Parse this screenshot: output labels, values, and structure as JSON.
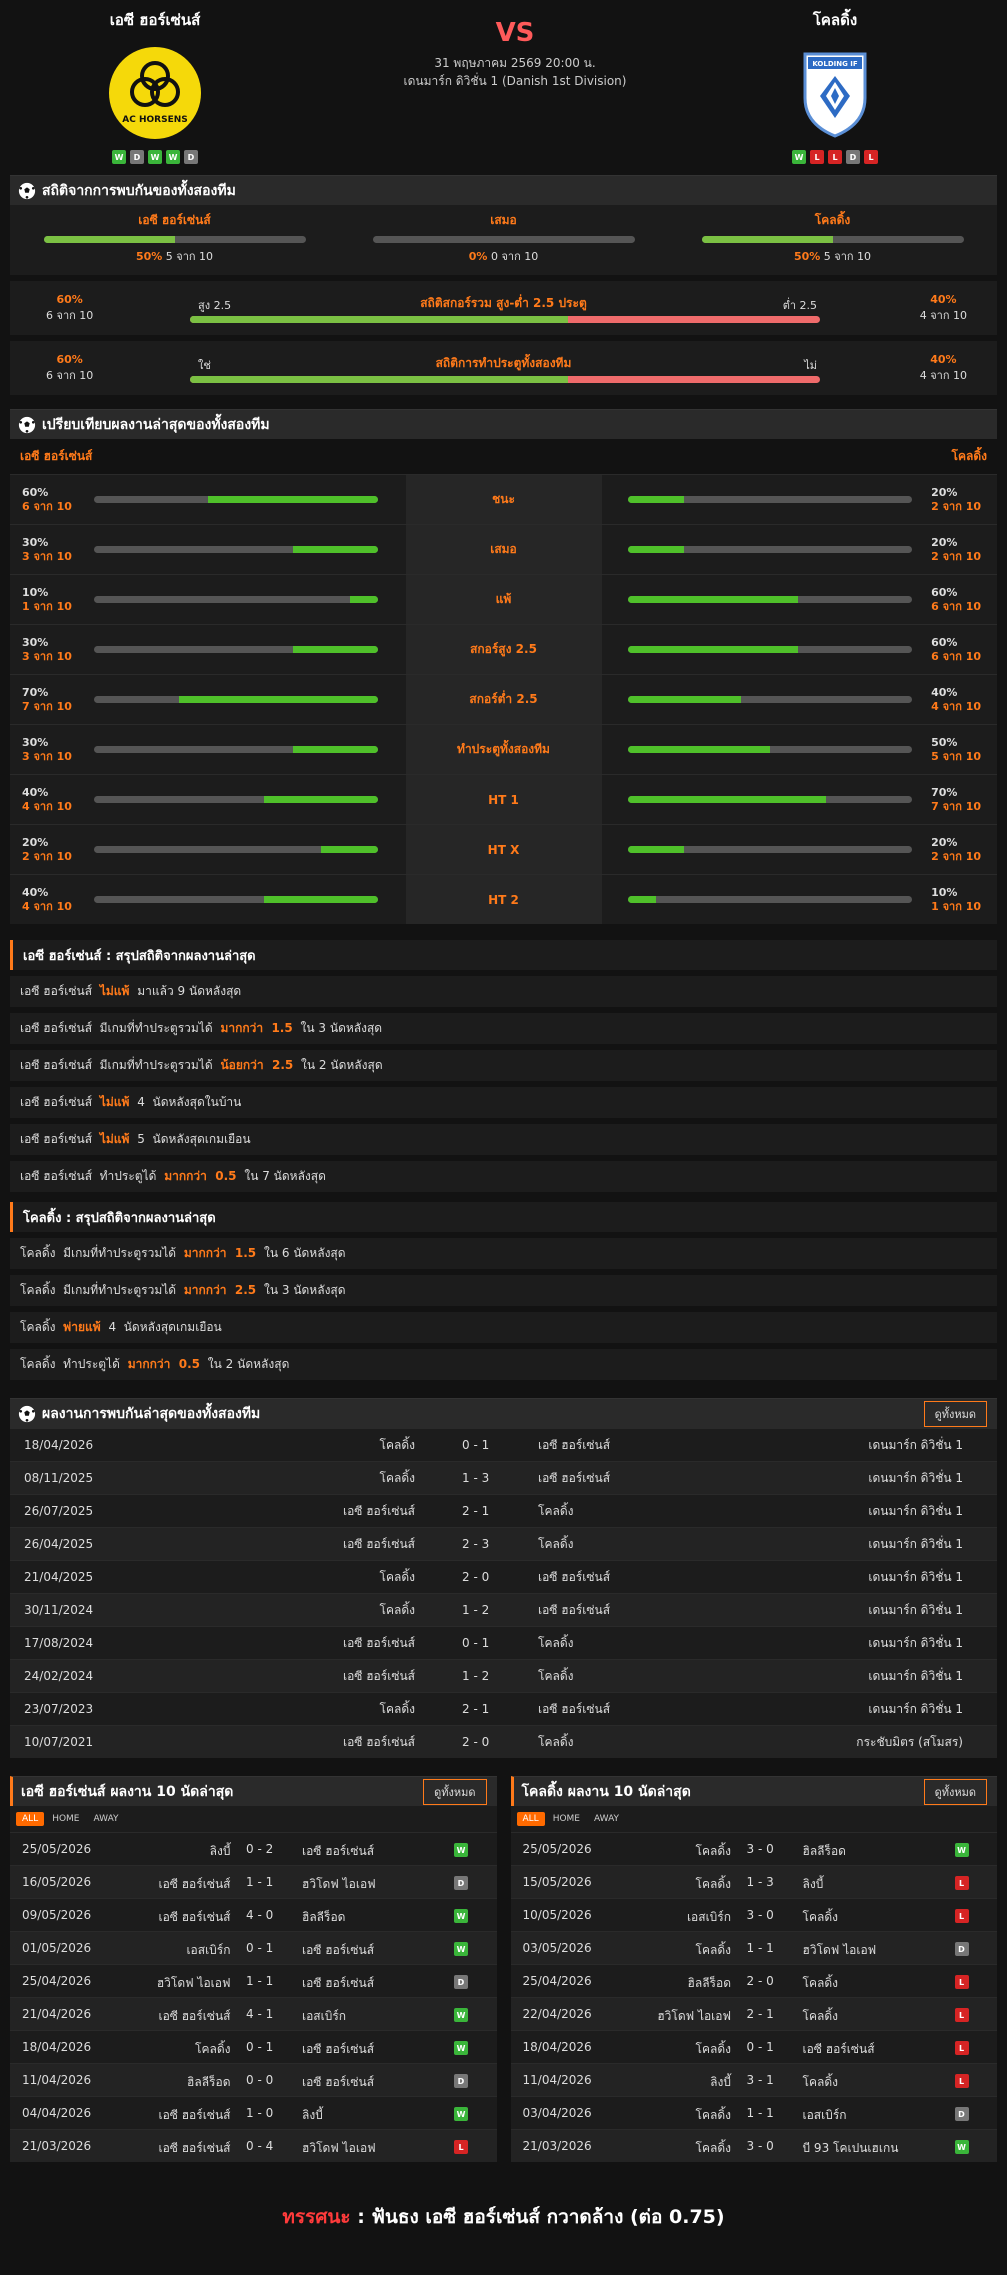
{
  "match": {
    "home": "เอซี ฮอร์เซ่นส์",
    "away": "โคลดิ้ง",
    "vs": "VS",
    "datetime": "31 พฤษภาคม 2569 20:00 น.",
    "league": "เดนมาร์ก ดิวิชั่น 1 (Danish 1st Division)",
    "home_logo_text": "AC HORSENS",
    "away_logo_text": "KOLDING IF",
    "home_form": [
      "W",
      "D",
      "W",
      "W",
      "D"
    ],
    "away_form": [
      "W",
      "L",
      "L",
      "D",
      "L"
    ]
  },
  "h2h_stats": {
    "title": "สถิติจากการพบกันของทั้งสองทีม",
    "cols": [
      {
        "label": "เอซี ฮอร์เซ่นส์",
        "pct": "50%",
        "count": "5 จาก 10",
        "value": 0.5
      },
      {
        "label": "เสมอ",
        "pct": "0%",
        "count": "0 จาก 10",
        "value": 0
      },
      {
        "label": "โคลดิ้ง",
        "pct": "50%",
        "count": "5 จาก 10",
        "value": 0.5
      }
    ],
    "ou": {
      "lp": "60%",
      "lc": "6 จาก 10",
      "lt": "สูง 2.5",
      "title": "สถิติสกอร์รวม สูง-ต่ำ 2.5 ประตู",
      "rt": "ต่ำ 2.5",
      "rp": "40%",
      "rc": "4 จาก 10",
      "value": 0.6
    },
    "btts": {
      "lp": "60%",
      "lc": "6 จาก 10",
      "lt": "ใช่",
      "title": "สถิติการทำประตูทั้งสองทีม",
      "rt": "ไม่",
      "rp": "40%",
      "rc": "4 จาก 10",
      "value": 0.6
    }
  },
  "compare": {
    "title": "เปรียบเทียบผลงานล่าสุดของทั้งสองทีม",
    "home": "เอซี ฮอร์เซ่นส์",
    "away": "โคลดิ้ง",
    "rows": [
      {
        "label": "ชนะ",
        "hp": "60%",
        "hc": "6 จาก 10",
        "hv": 0.6,
        "ap": "20%",
        "ac": "2 จาก 10",
        "av": 0.2
      },
      {
        "label": "เสมอ",
        "hp": "30%",
        "hc": "3 จาก 10",
        "hv": 0.3,
        "ap": "20%",
        "ac": "2 จาก 10",
        "av": 0.2
      },
      {
        "label": "แพ้",
        "hp": "10%",
        "hc": "1 จาก 10",
        "hv": 0.1,
        "ap": "60%",
        "ac": "6 จาก 10",
        "av": 0.6
      },
      {
        "label": "สกอร์สูง 2.5",
        "hp": "30%",
        "hc": "3 จาก 10",
        "hv": 0.3,
        "ap": "60%",
        "ac": "6 จาก 10",
        "av": 0.6
      },
      {
        "label": "สกอร์ต่ำ 2.5",
        "hp": "70%",
        "hc": "7 จาก 10",
        "hv": 0.7,
        "ap": "40%",
        "ac": "4 จาก 10",
        "av": 0.4
      },
      {
        "label": "ทำประตูทั้งสองทีม",
        "hp": "30%",
        "hc": "3 จาก 10",
        "hv": 0.3,
        "ap": "50%",
        "ac": "5 จาก 10",
        "av": 0.5
      },
      {
        "label": "HT 1",
        "hp": "40%",
        "hc": "4 จาก 10",
        "hv": 0.4,
        "ap": "70%",
        "ac": "7 จาก 10",
        "av": 0.7
      },
      {
        "label": "HT X",
        "hp": "20%",
        "hc": "2 จาก 10",
        "hv": 0.2,
        "ap": "20%",
        "ac": "2 จาก 10",
        "av": 0.2
      },
      {
        "label": "HT 2",
        "hp": "40%",
        "hc": "4 จาก 10",
        "hv": 0.4,
        "ap": "10%",
        "ac": "1 จาก 10",
        "av": 0.1
      }
    ]
  },
  "home_summary": {
    "title": "เอซี ฮอร์เซ่นส์ : สรุปสถิติจากผลงานล่าสุด",
    "rows": [
      [
        "เอซี ฮอร์เซ่นส์ ",
        "ไม่แพ้",
        " มาแล้ว 9 นัดหลังสุด"
      ],
      [
        "เอซี ฮอร์เซ่นส์  มีเกมที่ทำประตูรวมได้ ",
        "มากกว่า  1.5",
        " ใน 3 นัดหลังสุด"
      ],
      [
        "เอซี ฮอร์เซ่นส์  มีเกมที่ทำประตูรวมได้ ",
        "น้อยกว่า  2.5",
        " ใน 2 นัดหลังสุด"
      ],
      [
        "เอซี ฮอร์เซ่นส์ ",
        "ไม่แพ้",
        " 4  นัดหลังสุดในบ้าน"
      ],
      [
        "เอซี ฮอร์เซ่นส์ ",
        "ไม่แพ้",
        " 5  นัดหลังสุดเกมเยือน"
      ],
      [
        "เอซี ฮอร์เซ่นส์  ทำประตูได้ ",
        "มากกว่า  0.5",
        " ใน 7 นัดหลังสุด"
      ]
    ]
  },
  "away_summary": {
    "title": "โคลดิ้ง : สรุปสถิติจากผลงานล่าสุด",
    "rows": [
      [
        "โคลดิ้ง  มีเกมที่ทำประตูรวมได้ ",
        "มากกว่า  1.5",
        " ใน 6 นัดหลังสุด"
      ],
      [
        "โคลดิ้ง  มีเกมที่ทำประตูรวมได้ ",
        "มากกว่า  2.5",
        " ใน 3 นัดหลังสุด"
      ],
      [
        "โคลดิ้ง ",
        "พ่ายแพ้",
        " 4  นัดหลังสุดเกมเยือน"
      ],
      [
        "โคลดิ้ง  ทำประตูได้ ",
        "มากกว่า  0.5",
        " ใน 2 นัดหลังสุด"
      ]
    ]
  },
  "h2h_matches": {
    "title": "ผลงานการพบกันล่าสุดของทั้งสองทีม",
    "view_all": "ดูทั้งหมด",
    "rows": [
      [
        "18/04/2026",
        "โคลดิ้ง",
        "0 - 1",
        "เอซี ฮอร์เซ่นส์",
        "เดนมาร์ก ดิวิชั่น 1"
      ],
      [
        "08/11/2025",
        "โคลดิ้ง",
        "1 - 3",
        "เอซี ฮอร์เซ่นส์",
        "เดนมาร์ก ดิวิชั่น 1"
      ],
      [
        "26/07/2025",
        "เอซี ฮอร์เซ่นส์",
        "2 - 1",
        "โคลดิ้ง",
        "เดนมาร์ก ดิวิชั่น 1"
      ],
      [
        "26/04/2025",
        "เอซี ฮอร์เซ่นส์",
        "2 - 3",
        "โคลดิ้ง",
        "เดนมาร์ก ดิวิชั่น 1"
      ],
      [
        "21/04/2025",
        "โคลดิ้ง",
        "2 - 0",
        "เอซี ฮอร์เซ่นส์",
        "เดนมาร์ก ดิวิชั่น 1"
      ],
      [
        "30/11/2024",
        "โคลดิ้ง",
        "1 - 2",
        "เอซี ฮอร์เซ่นส์",
        "เดนมาร์ก ดิวิชั่น 1"
      ],
      [
        "17/08/2024",
        "เอซี ฮอร์เซ่นส์",
        "0 - 1",
        "โคลดิ้ง",
        "เดนมาร์ก ดิวิชั่น 1"
      ],
      [
        "24/02/2024",
        "เอซี ฮอร์เซ่นส์",
        "1 - 2",
        "โคลดิ้ง",
        "เดนมาร์ก ดิวิชั่น 1"
      ],
      [
        "23/07/2023",
        "โคลดิ้ง",
        "2 - 1",
        "เอซี ฮอร์เซ่นส์",
        "เดนมาร์ก ดิวิชั่น 1"
      ],
      [
        "10/07/2021",
        "เอซี ฮอร์เซ่นส์",
        "2 - 0",
        "โคลดิ้ง",
        "กระชับมิตร (สโมสร)"
      ]
    ]
  },
  "home_last10": {
    "title": "เอซี ฮอร์เซ่นส์ ผลงาน 10 นัดล่าสุด",
    "view_all": "ดูทั้งหมด",
    "tabs": [
      "ALL",
      "HOME",
      "AWAY"
    ],
    "rows": [
      [
        "25/05/2026",
        "ลิงบี้",
        "0 - 2",
        "เอซี ฮอร์เซ่นส์",
        "W"
      ],
      [
        "16/05/2026",
        "เอซี ฮอร์เซ่นส์",
        "1 - 1",
        "ฮวิโดฟ ไอเอฟ",
        "D"
      ],
      [
        "09/05/2026",
        "เอซี ฮอร์เซ่นส์",
        "4 - 0",
        "ฮิลลีร็อด",
        "W"
      ],
      [
        "01/05/2026",
        "เอสเบิร์ก",
        "0 - 1",
        "เอซี ฮอร์เซ่นส์",
        "W"
      ],
      [
        "25/04/2026",
        "ฮวิโดฟ ไอเอฟ",
        "1 - 1",
        "เอซี ฮอร์เซ่นส์",
        "D"
      ],
      [
        "21/04/2026",
        "เอซี ฮอร์เซ่นส์",
        "4 - 1",
        "เอสเบิร์ก",
        "W"
      ],
      [
        "18/04/2026",
        "โคลดิ้ง",
        "0 - 1",
        "เอซี ฮอร์เซ่นส์",
        "W"
      ],
      [
        "11/04/2026",
        "ฮิลลีร็อด",
        "0 - 0",
        "เอซี ฮอร์เซ่นส์",
        "D"
      ],
      [
        "04/04/2026",
        "เอซี ฮอร์เซ่นส์",
        "1 - 0",
        "ลิงบี้",
        "W"
      ],
      [
        "21/03/2026",
        "เอซี ฮอร์เซ่นส์",
        "0 - 4",
        "ฮวิโดฟ ไอเอฟ",
        "L"
      ]
    ]
  },
  "away_last10": {
    "title": "โคลดิ้ง ผลงาน 10 นัดล่าสุด",
    "view_all": "ดูทั้งหมด",
    "tabs": [
      "ALL",
      "HOME",
      "AWAY"
    ],
    "rows": [
      [
        "25/05/2026",
        "โคลดิ้ง",
        "3 - 0",
        "ฮิลลีร็อด",
        "W"
      ],
      [
        "15/05/2026",
        "โคลดิ้ง",
        "1 - 3",
        "ลิงบี้",
        "L"
      ],
      [
        "10/05/2026",
        "เอสเบิร์ก",
        "3 - 0",
        "โคลดิ้ง",
        "L"
      ],
      [
        "03/05/2026",
        "โคลดิ้ง",
        "1 - 1",
        "ฮวิโดฟ ไอเอฟ",
        "D"
      ],
      [
        "25/04/2026",
        "ฮิลลีร็อด",
        "2 - 0",
        "โคลดิ้ง",
        "L"
      ],
      [
        "22/04/2026",
        "ฮวิโดฟ ไอเอฟ",
        "2 - 1",
        "โคลดิ้ง",
        "L"
      ],
      [
        "18/04/2026",
        "โคลดิ้ง",
        "0 - 1",
        "เอซี ฮอร์เซ่นส์",
        "L"
      ],
      [
        "11/04/2026",
        "ลิงบี้",
        "3 - 1",
        "โคลดิ้ง",
        "L"
      ],
      [
        "03/04/2026",
        "โคลดิ้ง",
        "1 - 1",
        "เอสเบิร์ก",
        "D"
      ],
      [
        "21/03/2026",
        "โคลดิ้ง",
        "3 - 0",
        "บี 93 โคเปนเฮเกน",
        "W"
      ]
    ]
  },
  "prediction": {
    "label": "ทรรศนะ",
    "sep": " :  ",
    "text": "ฟันธง เอซี ฮอร์เซ่นส์ กวาดล้าง (ต่อ 0.75)"
  }
}
